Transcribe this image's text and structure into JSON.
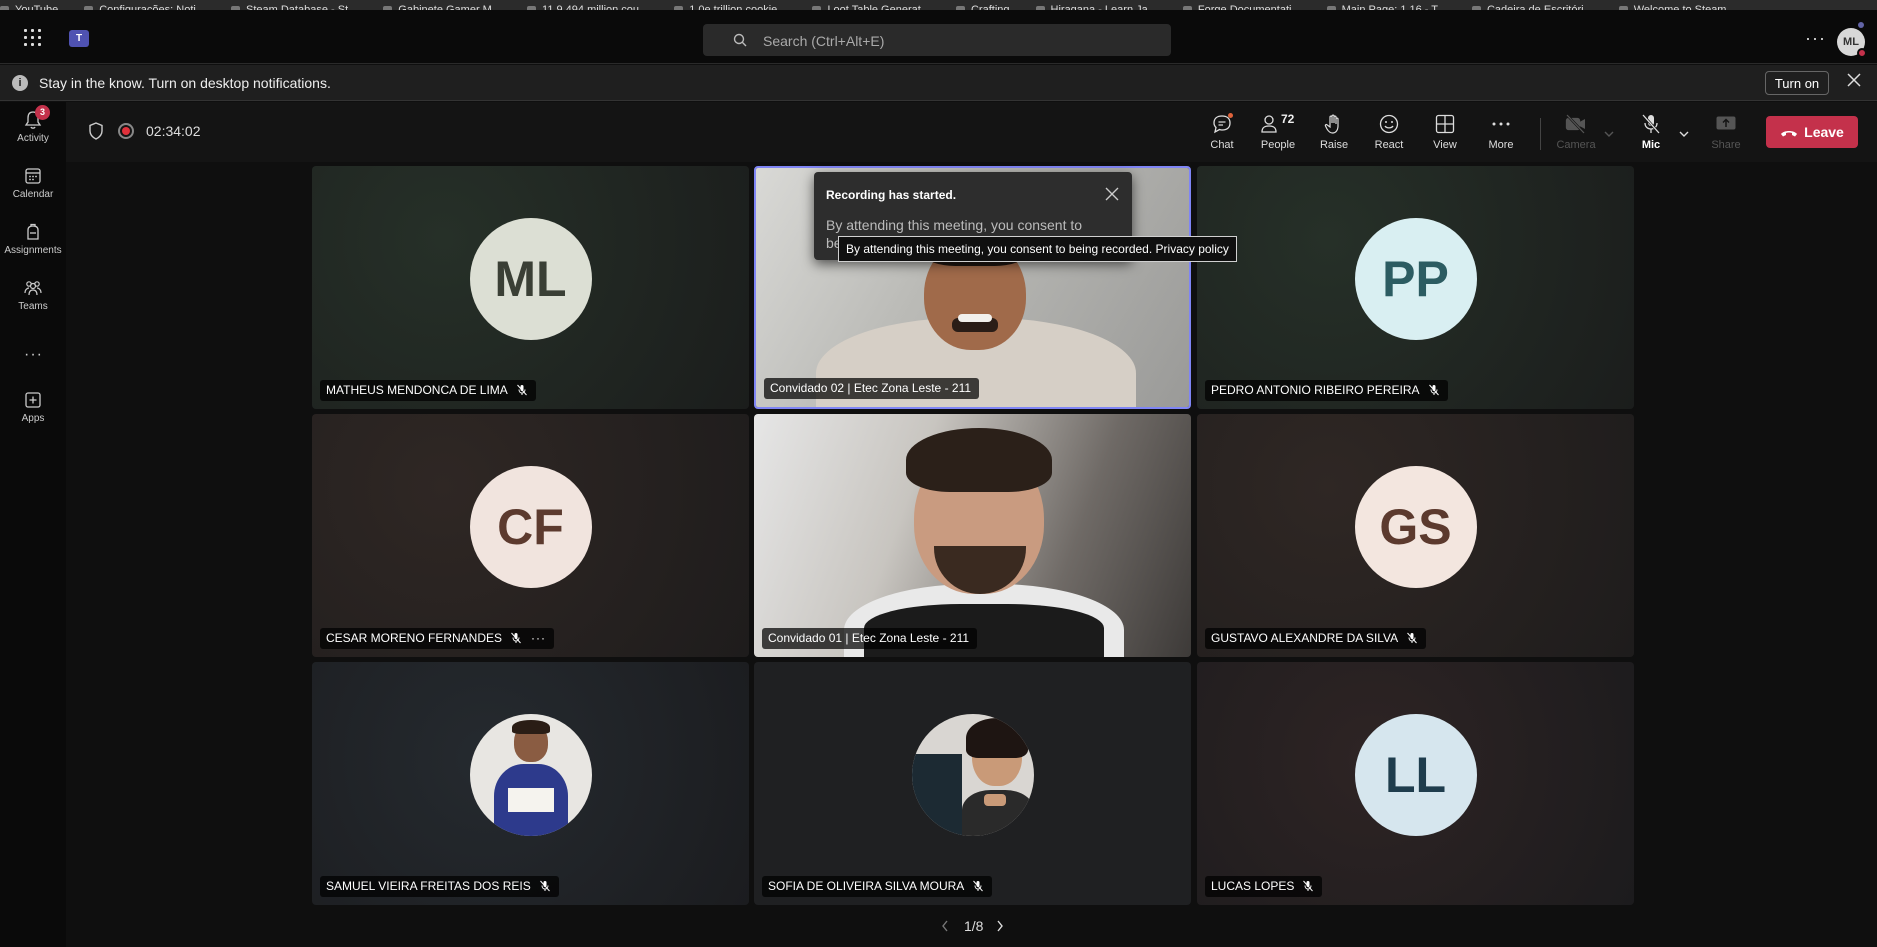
{
  "bookmarks": [
    "YouTube",
    "Configurações: Noti...",
    "Steam Database - St...",
    "Gabinete Gamer M...",
    "11.9.494 million cou...",
    "1.0e trillion cookie...",
    "Loot Table Generat...",
    "Crafting",
    "Hiragana - Learn Ja...",
    "Forge Documentati...",
    "Main Page: 1.16 - T...",
    "Cadeira de Escritóri...",
    "Welcome to Steam"
  ],
  "titlebar": {
    "search_placeholder": "Search (Ctrl+Alt+E)",
    "more_label": "···",
    "avatar_initials": "ML"
  },
  "notification": {
    "text": "Stay in the know. Turn on desktop notifications.",
    "button": "Turn on"
  },
  "rail": {
    "activity_badge": "3",
    "items": [
      {
        "label": "Activity"
      },
      {
        "label": "Calendar"
      },
      {
        "label": "Assignments"
      },
      {
        "label": "Teams"
      },
      {
        "label": "Apps"
      }
    ],
    "more": "···"
  },
  "toolbar": {
    "timer": "02:34:02",
    "chat": "Chat",
    "people": "People",
    "people_count": "72",
    "raise": "Raise",
    "react": "React",
    "view": "View",
    "more": "More",
    "camera": "Camera",
    "mic": "Mic",
    "share": "Share",
    "leave": "Leave"
  },
  "participants": [
    {
      "name": "MATHEUS MENDONCA DE LIMA",
      "initials": "ML",
      "avatar_color": "#dcdfd4",
      "initials_color": "#3a3f35"
    },
    {
      "name": "Convidado 02 | Etec Zona Leste - 211"
    },
    {
      "name": "PEDRO ANTONIO RIBEIRO PEREIRA",
      "initials": "PP",
      "avatar_color": "#d9eff2",
      "initials_color": "#2c5c62"
    },
    {
      "name": "CESAR MORENO FERNANDES",
      "initials": "CF",
      "avatar_color": "#f1e4de",
      "initials_color": "#5c3a2e",
      "more": "···"
    },
    {
      "name": "Convidado 01 | Etec Zona Leste - 211"
    },
    {
      "name": "GUSTAVO ALEXANDRE DA SILVA",
      "initials": "GS",
      "avatar_color": "#f3e6df",
      "initials_color": "#5c3a2e"
    },
    {
      "name": "SAMUEL VIEIRA FREITAS DOS REIS"
    },
    {
      "name": "SOFIA DE OLIVEIRA SILVA MOURA"
    },
    {
      "name": "LUCAS LOPES",
      "initials": "LL",
      "avatar_color": "#d6e6ee",
      "initials_color": "#1f3d4d"
    }
  ],
  "recording_popup": {
    "title": "Recording has started.",
    "body": "By attending this meeting, you consent to be",
    "tooltip": "By attending this meeting, you consent to being recorded. Privacy policy"
  },
  "pager": {
    "text": "1/8"
  },
  "colors": {
    "accent": "#6264a7",
    "leave": "#c4314b",
    "active_border": "#7f85f5"
  }
}
